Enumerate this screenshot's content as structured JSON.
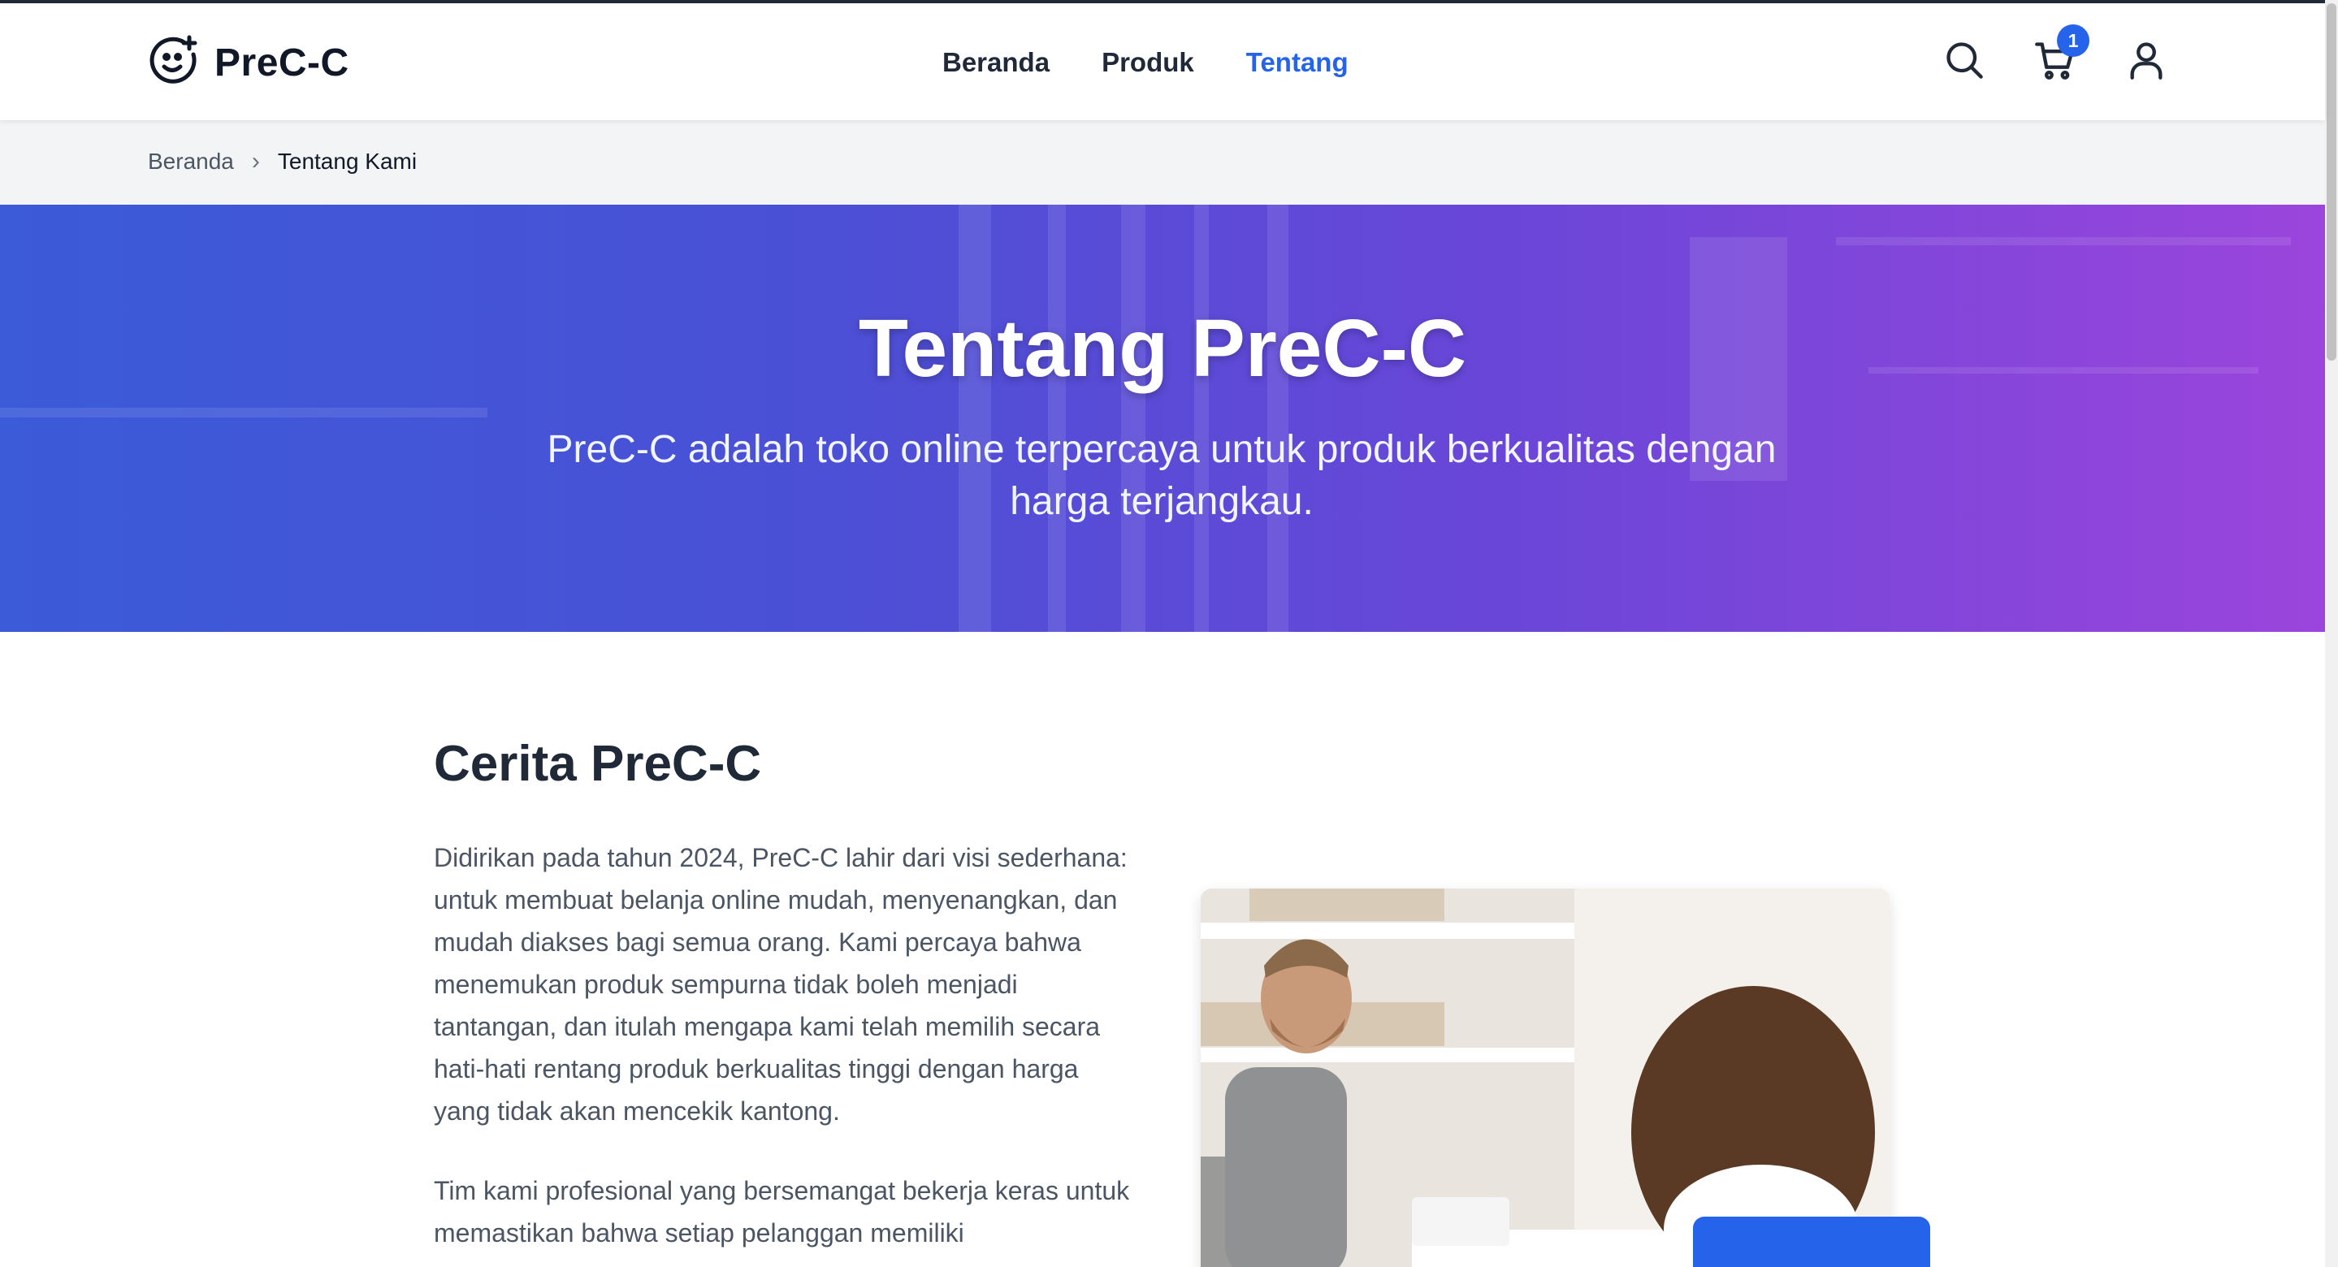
{
  "brand": {
    "name": "PreC-C",
    "logo_icon": "smile-plus-icon"
  },
  "nav": {
    "items": [
      {
        "label": "Beranda",
        "active": false
      },
      {
        "label": "Produk",
        "active": false
      },
      {
        "label": "Tentang",
        "active": true
      }
    ]
  },
  "header_icons": {
    "search": "search-icon",
    "cart": "cart-icon",
    "cart_count": "1",
    "user": "user-icon"
  },
  "breadcrumb": {
    "home": "Beranda",
    "separator": "›",
    "current": "Tentang Kami"
  },
  "hero": {
    "title": "Tentang PreC-C",
    "subtitle": "PreC-C adalah toko online terpercaya untuk produk berkualitas dengan harga terjangkau."
  },
  "story": {
    "title": "Cerita PreC-C",
    "paragraph1": "Didirikan pada tahun 2024, PreC-C lahir dari visi sederhana: untuk membuat belanja online mudah, menyenangkan, dan mudah diakses bagi semua orang. Kami percaya bahwa menemukan produk sempurna tidak boleh menjadi tantangan, dan itulah mengapa kami telah memilih secara hati-hati rentang produk berkualitas tinggi dengan harga yang tidak akan mencekik kantong.",
    "paragraph2": "Tim kami profesional yang bersemangat bekerja keras untuk memastikan bahwa setiap pelanggan memiliki"
  },
  "colors": {
    "accent": "#2563eb",
    "hero_start": "#3b5bd8",
    "hero_end": "#9b45dc",
    "text_dark": "#1f2937"
  }
}
